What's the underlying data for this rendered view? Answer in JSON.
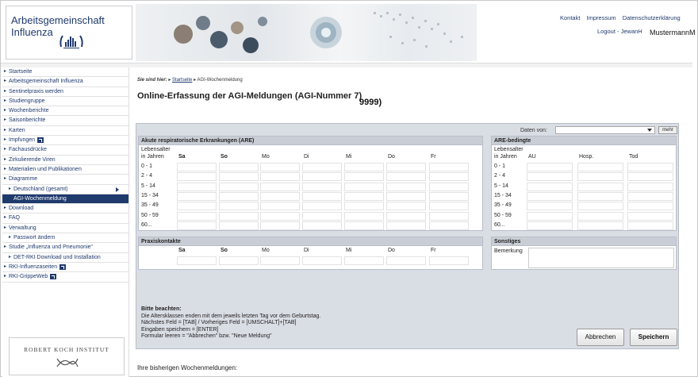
{
  "header": {
    "site_title": "Arbeitsgemeinschaft Influenza",
    "links": [
      "Kontakt",
      "Impressum",
      "Datenschutzerklärung"
    ],
    "logout": "Logout - JewanH",
    "username": "MustermannM"
  },
  "sidebar": {
    "items": [
      {
        "label": "Startseite",
        "level": 0
      },
      {
        "label": "Arbeitsgemeinschaft Influenza",
        "level": 0
      },
      {
        "label": "Sentinelpraxis werden",
        "level": 0
      },
      {
        "label": "Studiengruppe",
        "level": 0
      },
      {
        "label": "Wochenberichte",
        "level": 0
      },
      {
        "label": "Saisonberichte",
        "level": 0
      },
      {
        "label": "Karten",
        "level": 0
      },
      {
        "label": "Impfungen",
        "level": 0,
        "external": true
      },
      {
        "label": "Fachausdrücke",
        "level": 0
      },
      {
        "label": "Zirkulierende Viren",
        "level": 0
      },
      {
        "label": "Materialien und Publikationen",
        "level": 0
      },
      {
        "label": "Diagramme",
        "level": 0
      },
      {
        "label": "Deutschland (gesamt)",
        "level": 1,
        "submenu": true
      },
      {
        "label": "AGI-Wochenmeldung",
        "level": 1,
        "active": true
      },
      {
        "label": "Download",
        "level": 0
      },
      {
        "label": "FAQ",
        "level": 0
      },
      {
        "label": "Verwaltung",
        "level": 0
      },
      {
        "label": "Passwort ändern",
        "level": 1
      },
      {
        "label": "Studie „Influenza und Pneumonie“",
        "level": 0
      },
      {
        "label": "DET-RKI Download und Installation",
        "level": 1
      },
      {
        "label": "RKI-Influenzaseiten",
        "level": 0,
        "external": true
      },
      {
        "label": "RKI-GrippeWeb",
        "level": 0,
        "external": true
      }
    ],
    "rki_logo_text": "ROBERT KOCH INSTITUT"
  },
  "main": {
    "breadcrumb_label": "Sie sind hier:",
    "breadcrumb_home": "Startseite",
    "breadcrumb_current": "AGI-Wochenmeldung",
    "title": "Online-Erfassung der AGI-Meldungen (AGI-Nummer 7)",
    "title_suffix": "9999)",
    "daten_von_label": "Daten von:",
    "daten_von_value": "",
    "mehr_label": "mehr",
    "are": {
      "heading": "Akute respiratorische Erkrankungen (ARE)",
      "age_header_1": "Lebensalter",
      "age_header_2": "in Jahren",
      "days": [
        "Sa",
        "So",
        "Mo",
        "Di",
        "Mi",
        "Do",
        "Fr"
      ],
      "bold_days": [
        "Sa",
        "So"
      ],
      "ages": [
        "0 - 1",
        "2 - 4",
        "5 - 14",
        "15 - 34",
        "35 - 49",
        "50 - 59",
        "60..."
      ]
    },
    "are_bedingt": {
      "heading": "ARE-bedingte",
      "age_header_1": "Lebensalter",
      "age_header_2": "in Jahren",
      "cols": [
        "AU",
        "Hosp.",
        "Tod"
      ],
      "ages": [
        "0 - 1",
        "2 - 4",
        "5 - 14",
        "15 - 34",
        "35 - 49",
        "50 - 59",
        "60..."
      ]
    },
    "praxiskontakte": {
      "heading": "Praxiskontakte",
      "days": [
        "Sa",
        "So",
        "Mo",
        "Di",
        "Mi",
        "Do",
        "Fr"
      ]
    },
    "sonstiges": {
      "heading": "Sonstiges",
      "bemerkung_label": "Bemerkung"
    },
    "hint": {
      "title": "Bitte beachten:",
      "lines": [
        "Die Altersklassen enden mit dem jeweils letzten Tag vor dem Geburtstag.",
        "Nächstes Feld = [TAB] / Vorheriges Feld = [UMSCHALT]+[TAB]",
        "Eingaben speichern = [ENTER]",
        "Formular leeren = \"Abbrechen\" bzw. \"Neue Meldung\""
      ]
    },
    "buttons": {
      "cancel": "Abbrechen",
      "save": "Speichern"
    },
    "previous_reports": "Ihre bisherigen Wochenmeldungen:"
  },
  "colors": {
    "brand": "#1f3a6d",
    "panel_bg": "#d9dde4",
    "panel_head": "#c9ced6"
  }
}
